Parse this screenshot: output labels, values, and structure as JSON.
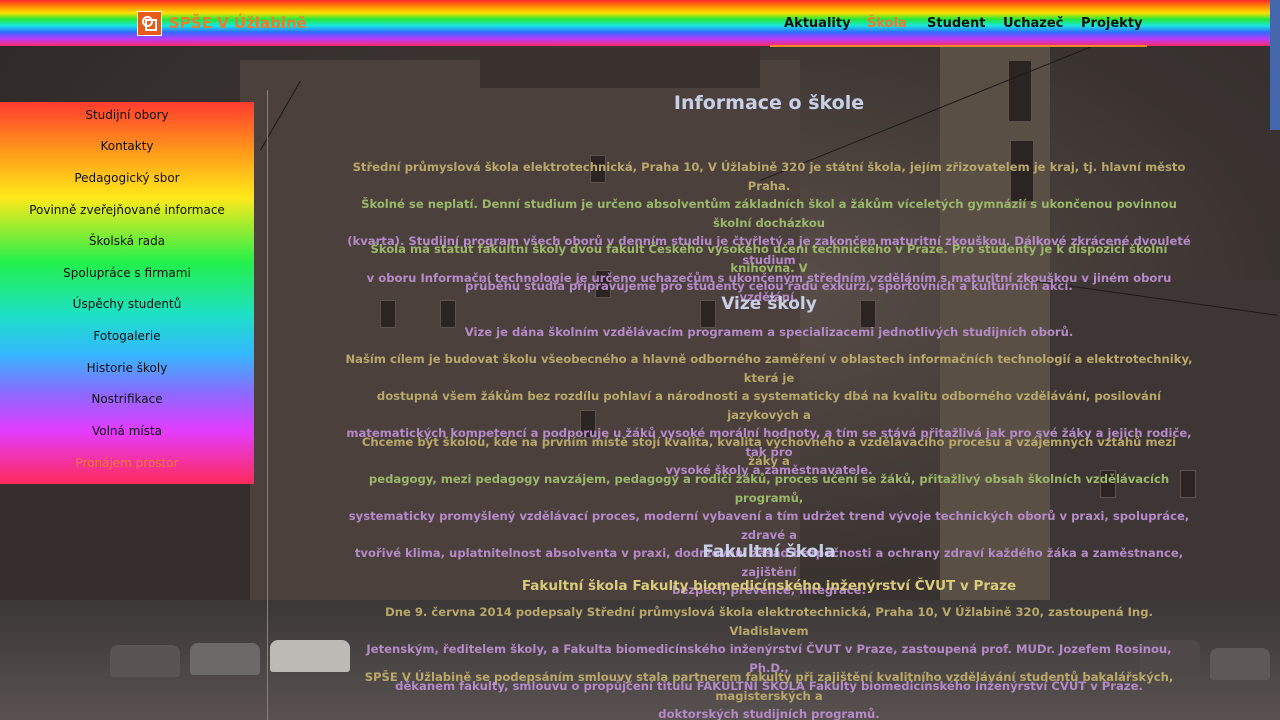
{
  "header": {
    "brand": "SPŠE V Úžlabině",
    "nav": [
      {
        "label": "Aktuality",
        "active": false
      },
      {
        "label": "Škola",
        "active": true
      },
      {
        "label": "Student",
        "active": false
      },
      {
        "label": "Uchazeč",
        "active": false
      },
      {
        "label": "Projekty",
        "active": false
      }
    ]
  },
  "sidebar": {
    "items": [
      {
        "label": "Studijní obory"
      },
      {
        "label": "Kontakty"
      },
      {
        "label": "Pedagogický sbor"
      },
      {
        "label": "Povinně zveřejňované informace"
      },
      {
        "label": "Školská rada"
      },
      {
        "label": "Spolupráce s firmami"
      },
      {
        "label": "Úspěchy studentů"
      },
      {
        "label": "Fotogalerie"
      },
      {
        "label": "Historie školy"
      },
      {
        "label": "Nostrifikace"
      },
      {
        "label": "Volná místa"
      },
      {
        "label": "Pronájem prostor"
      }
    ]
  },
  "main": {
    "title": "Informace o škole",
    "intro_lines": [
      "Střední průmyslová škola elektrotechnická, Praha 10, V Úžlabině 320 je státní škola, jejím zřizovatelem je kraj, tj. hlavní město Praha.",
      "Školné se neplatí. Denní studium je určeno absolventům základních škol a žákům víceletých gymnázií s ukončenou povinnou školní docházkou",
      "(kvarta). Studijní program všech oborů v denním studiu je čtyřletý a je zakončen maturitní zkouškou. Dálkové zkrácené dvouleté studium",
      "v oboru Informační technologie je určeno uchazečům s ukončeným středním vzděláním s maturitní zkouškou v jiném oboru vzdělání."
    ],
    "faculty_lines": [
      "Škola má statut fakultní školy dvou fakult Českého vysokého učení technického v Praze. Pro studenty je k dispozici školní knihovna. V",
      "průběhu studia připravujeme pro studenty celou řadu exkurzí, sportovních a kulturních akcí."
    ],
    "vision_title": "Vize školy",
    "vision_intro": "Vize je dána školním vzdělávacím programem a specializacemi jednotlivých studijních oborů.",
    "goal_lines": [
      "Naším cílem je budovat školu všeobecného a hlavně odborného zaměření v oblastech informačních technologií a elektrotechniky, která je",
      "dostupná všem žákům bez rozdílu pohlaví a národnosti a systematicky dbá na kvalitu odborného vzdělávání, posilování jazykových a",
      "matematických kompetencí a podporuje u žáků vysoké morální hodnoty, a tím se stává přitažlivá jak pro své žáky a jejich rodiče, tak pro",
      "vysoké školy a zaměstnavatele."
    ],
    "quality_lines": [
      "Chceme být školou, kde na prvním místě stojí kvalita, kvalita výchovného a vzdělávacího procesu a vzájemných vztahů mezi žáky a",
      "pedagogy, mezi pedagogy navzájem, pedagogy a rodiči žáků, proces učení se žáků, přitažlivý obsah školních vzdělávacích programů,",
      "systematicky promyšlený vzdělávací proces, moderní vybavení a tím udržet trend vývoje technických oborů v praxi, spolupráce, zdravé a",
      "tvořivé klima, uplatnitelnost absolventa v praxi, dodržování zásad bezpečnosti a ochrany zdraví každého žáka a zaměstnance, zajištění",
      "bezpečí, prevence, integrace."
    ],
    "faculty_school_title": "Fakultní škola",
    "faculty_school_subtitle": "Fakultní škola Fakulty biomedicínského inženýrství ČVUT v Praze",
    "agreement_lines": [
      "Dne 9. června 2014 podepsaly Střední průmyslová škola elektrotechnická, Praha 10, V Úžlabině 320, zastoupená Ing. Vladislavem",
      "Jetenským, ředitelem školy, a Fakulta biomedicínského inženýrství ČVUT v Praze, zastoupená prof. MUDr. Jozefem Rosinou, Ph.D.,",
      "děkanem fakulty, smlouvu o propůjčení titulu FAKULTNÍ ŠKOLA Fakulty biomedicínského inženýrství ČVUT v Praze."
    ],
    "partner_lines": [
      "SPŠE V Úžlabině se podepsáním smlouvy stala partnerem fakulty při zajištění kvalitního vzdělávání studentů bakalářských, magisterských a",
      "doktorských studijních programů."
    ]
  }
}
